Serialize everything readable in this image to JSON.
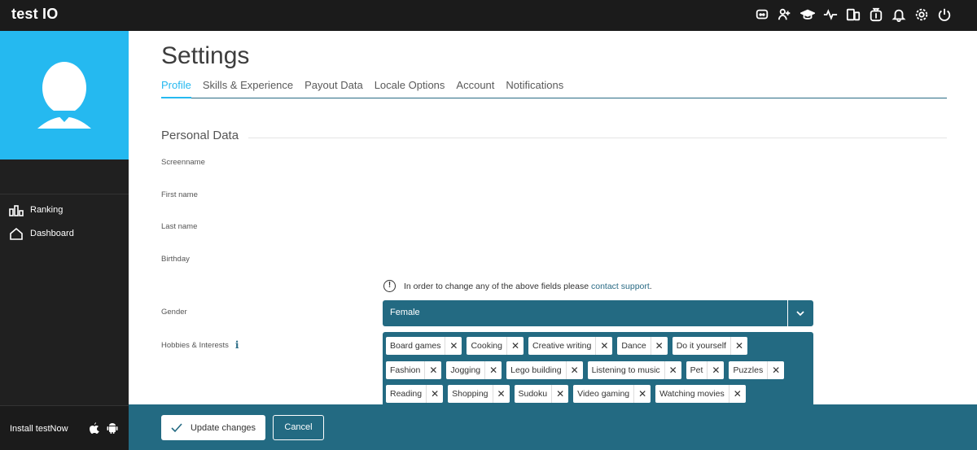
{
  "app": {
    "logo": "test IO"
  },
  "topbar": {
    "icons": [
      "discord-icon",
      "add-user-icon",
      "academy-icon",
      "activity-icon",
      "devices-icon",
      "payout-icon",
      "bell-icon",
      "gear-icon",
      "power-icon"
    ]
  },
  "sidebar": {
    "items": [
      {
        "label": "Ranking",
        "icon": "ranking-icon"
      },
      {
        "label": "Dashboard",
        "icon": "home-icon"
      }
    ],
    "install_label": "Install testNow"
  },
  "page": {
    "title": "Settings",
    "tabs": [
      {
        "label": "Profile",
        "active": true
      },
      {
        "label": "Skills & Experience",
        "active": false
      },
      {
        "label": "Payout Data",
        "active": false
      },
      {
        "label": "Locale Options",
        "active": false
      },
      {
        "label": "Account",
        "active": false
      },
      {
        "label": "Notifications",
        "active": false
      }
    ]
  },
  "personal_data": {
    "section_title": "Personal Data",
    "fields": {
      "screenname": "Screenname",
      "first_name": "First name",
      "last_name": "Last name",
      "birthday": "Birthday",
      "gender": "Gender",
      "hobbies": "Hobbies & Interests"
    },
    "notice": {
      "text": "In order to change any of the above fields please",
      "link": "contact support",
      "suffix": "."
    },
    "gender_value": "Female",
    "hobbies": [
      [
        "Board games",
        "Cooking",
        "Creative writing",
        "Dance",
        "Do it yourself"
      ],
      [
        "Fashion",
        "Jogging",
        "Lego building",
        "Listening to music",
        "Pet",
        "Puzzles"
      ],
      [
        "Reading",
        "Shopping",
        "Sudoku",
        "Video gaming",
        "Watching movies"
      ]
    ]
  },
  "footer": {
    "update_label": "Update changes",
    "cancel_label": "Cancel"
  },
  "colors": {
    "accent": "#25b9f0",
    "primary": "#236a82",
    "sidebar": "#202020",
    "topbar": "#1b1b1b"
  }
}
